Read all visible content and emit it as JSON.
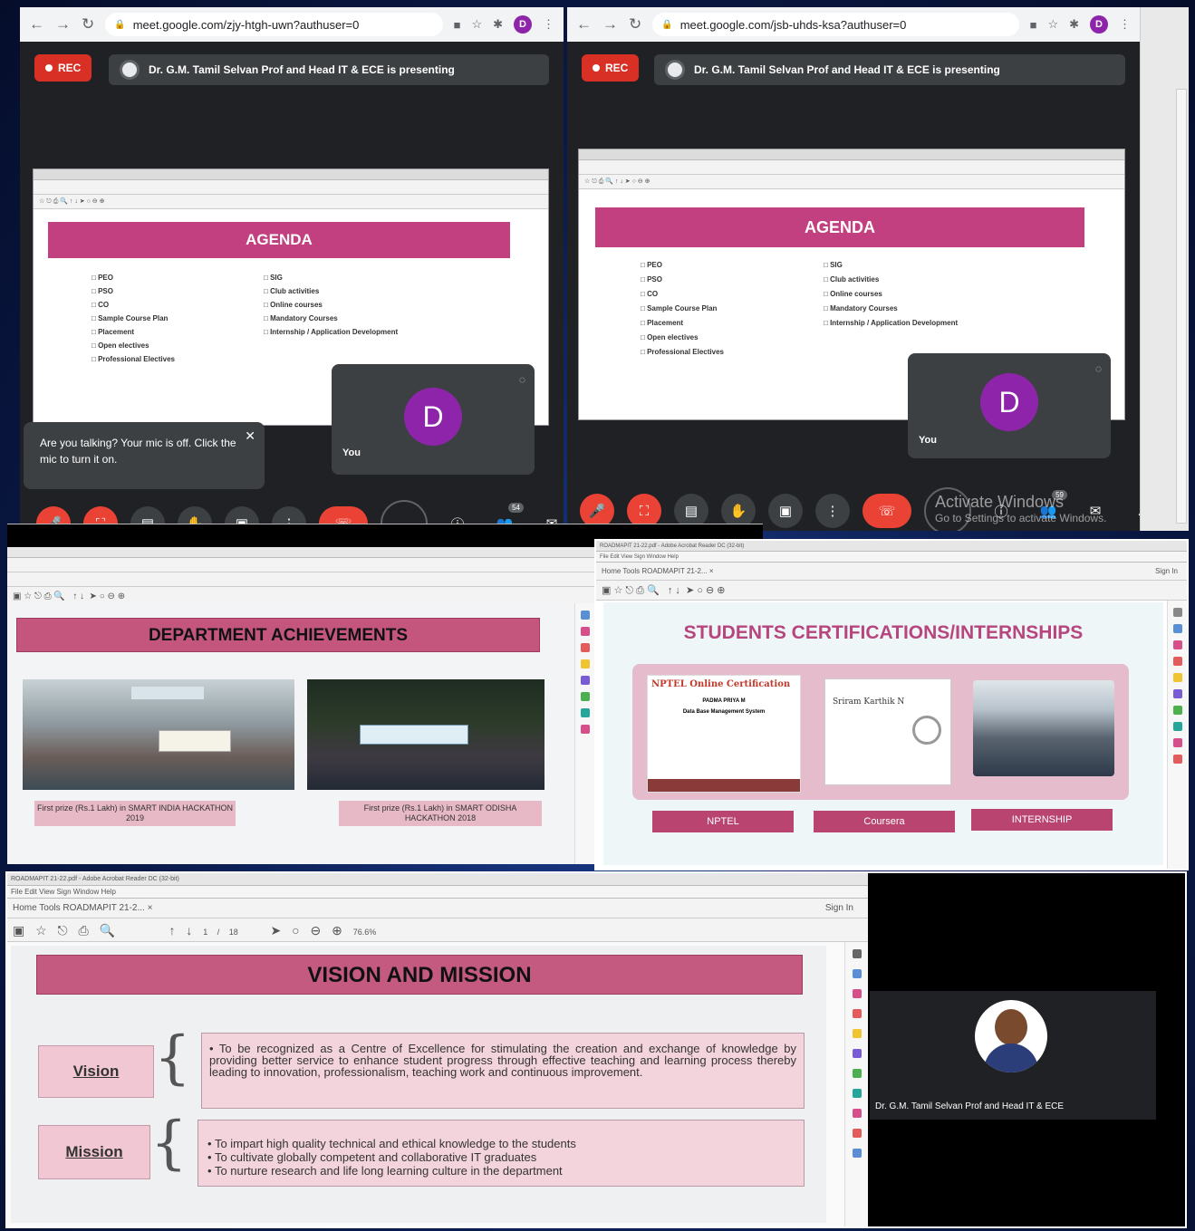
{
  "meet_left": {
    "url": "meet.google.com/zjy-htgh-uwn?authuser=0",
    "avatar_initial": "D",
    "rec_label": "REC",
    "presenting_text": "Dr. G.M. Tamil Selvan Prof and Head IT & ECE is presenting",
    "slide_title": "AGENDA",
    "agenda_col1": [
      "PEO",
      "PSO",
      "CO",
      "Sample Course  Plan",
      "Placement",
      "Open electives",
      "Professional Electives"
    ],
    "agenda_col2": [
      "SIG",
      "Club activities",
      "Online courses",
      "Mandatory Courses",
      "Internship / Application Development"
    ],
    "self_tile_initial": "D",
    "self_tile_label": "You",
    "tooltip_text": "Are you talking? Your mic is off. Click the mic to turn it on.",
    "participants": "54"
  },
  "meet_right": {
    "url": "meet.google.com/jsb-uhds-ksa?authuser=0",
    "avatar_initial": "D",
    "rec_label": "REC",
    "presenting_text": "Dr. G.M. Tamil Selvan Prof and Head IT & ECE is presenting",
    "slide_title": "AGENDA",
    "agenda_col1": [
      "PEO",
      "PSO",
      "CO",
      "Sample Course  Plan",
      "Placement",
      "Open electives",
      "Professional Electives"
    ],
    "agenda_col2": [
      "SIG",
      "Club activities",
      "Online courses",
      "Mandatory Courses",
      "Internship / Application Development"
    ],
    "self_tile_initial": "D",
    "self_tile_label": "You",
    "participants": "59",
    "watermark_line1": "Activate Windows",
    "watermark_line2": "Go to Settings to activate Windows."
  },
  "dept_slide": {
    "title": "DEPARTMENT ACHIEVEMENTS",
    "caption1": "First prize (Rs.1 Lakh) in SMART INDIA HACKATHON 2019",
    "caption2": "First prize (Rs.1 Lakh) in SMART ODISHA HACKATHON 2018"
  },
  "cert_slide": {
    "app_title": "ROADMAPIT 21-22.pdf - Adobe Acrobat Reader DC (32-bit)",
    "menu": "File  Edit  View  Sign  Window  Help",
    "tabs": "Home    Tools       ROADMAPIT 21-2...  ×",
    "sign_in": "Sign In",
    "title": "STUDENTS CERTIFICATIONS/INTERNSHIPS",
    "nptel_heading": "NPTEL Online Certification",
    "nptel_name": "PADMA PRIYA M",
    "nptel_course": "Data Base Management System",
    "coursera_name": "Sriram Karthik N",
    "btn1": "NPTEL",
    "btn2": "Coursera",
    "btn3": "INTERNSHIP"
  },
  "vm_slide": {
    "app_title": "ROADMAPIT 21-22.pdf - Adobe Acrobat Reader DC (32-bit)",
    "menu": "File  Edit  View  Sign  Window  Help",
    "tabs": "Home     Tools       ROADMAPIT 21-2...  ×",
    "sign_in": "Sign In",
    "toolbar_page": "1 / 18",
    "toolbar_zoom": "76.6%",
    "title": "VISION AND MISSION",
    "vision_label": "Vision",
    "vision_text": "To be recognized as a Centre of Excellence for stimulating the creation and exchange of knowledge by providing better service to enhance student progress through effective teaching and learning process thereby leading to innovation, professionalism, teaching work and continuous improvement.",
    "mission_label": "Mission",
    "mission_items": [
      "To impart high quality technical and ethical knowledge to the students",
      "To cultivate globally competent and collaborative IT graduates",
      "To nurture research and life long learning culture in the department"
    ],
    "speaker_name": "Dr. G.M. Tamil Selvan Prof and Head IT & ECE"
  },
  "colors": {
    "agenda_bar": "#c2407f",
    "rec": "#d93025",
    "meet_bg": "#202124",
    "avatar": "#8e24aa",
    "slide_pink": "#f3d4dd",
    "button_magenta": "#b8446f"
  }
}
